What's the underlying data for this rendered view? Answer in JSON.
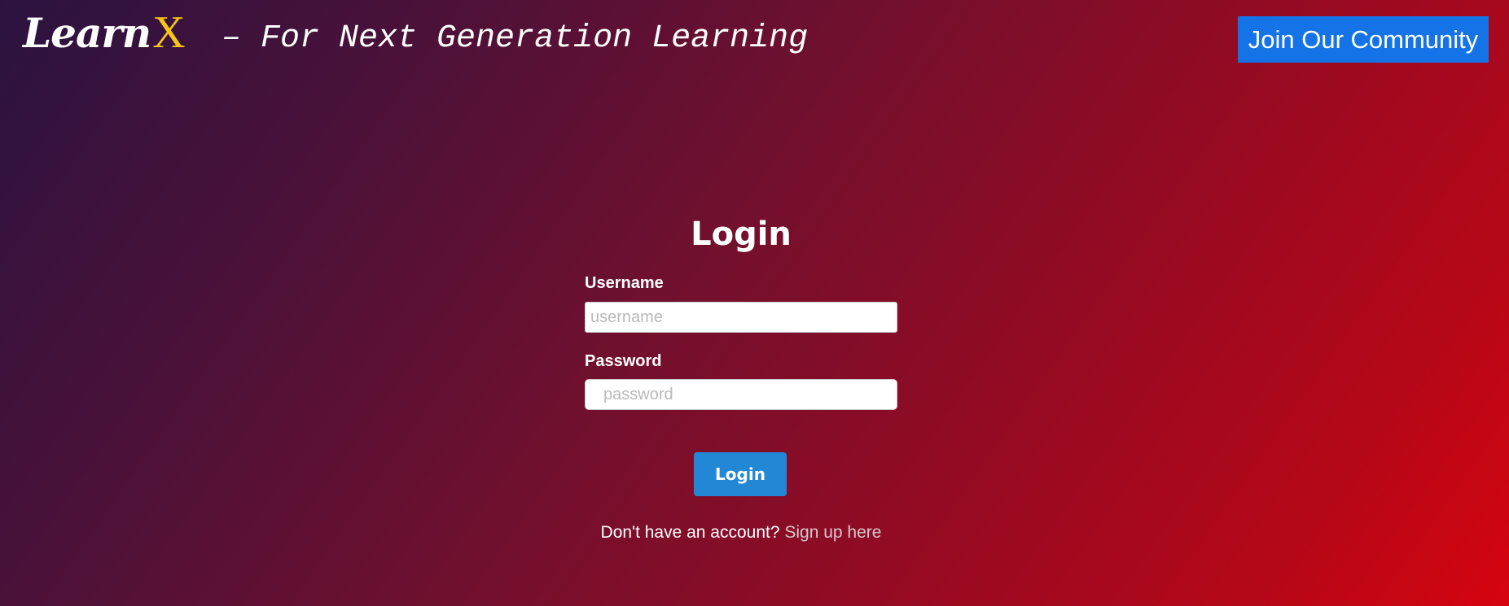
{
  "header": {
    "brand_main": "Learn",
    "brand_accent": "X",
    "tagline": "– For Next Generation Learning",
    "join_label": "Join Our Community"
  },
  "login": {
    "title": "Login",
    "username_label": "Username",
    "username_placeholder": "username",
    "username_value": "",
    "password_label": "Password",
    "password_placeholder": "password",
    "password_value": "",
    "submit_label": "Login",
    "signup_prompt": "Don't have an account?",
    "signup_link": "Sign up here"
  },
  "colors": {
    "accent_yellow": "#f5c518",
    "join_button": "#1473e6",
    "login_button": "#2288d6",
    "gradient_start": "#2b1340",
    "gradient_end": "#d6040f"
  }
}
